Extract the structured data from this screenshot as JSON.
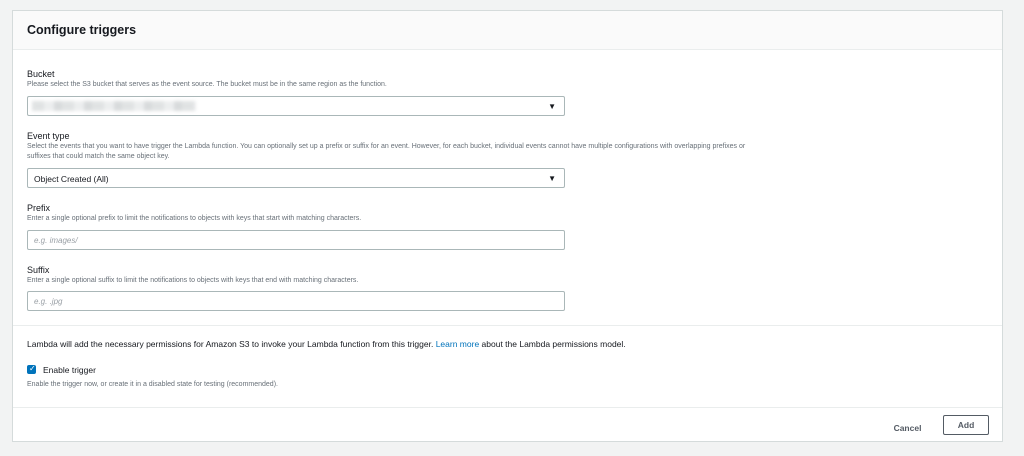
{
  "panel": {
    "title": "Configure triggers"
  },
  "bucket": {
    "label": "Bucket",
    "description": "Please select the S3 bucket that serves as the event source. The bucket must be in the same region as the function.",
    "selected_value_redacted": true
  },
  "event_type": {
    "label": "Event type",
    "description": "Select the events that you want to have trigger the Lambda function. You can optionally set up a prefix or suffix for an event. However, for each bucket, individual events cannot have multiple configurations with overlapping prefixes or suffixes that could match the same object key.",
    "selected_value": "Object Created (All)"
  },
  "prefix": {
    "label": "Prefix",
    "description": "Enter a single optional prefix to limit the notifications to objects with keys that start with matching characters.",
    "placeholder": "e.g. images/",
    "value": ""
  },
  "suffix": {
    "label": "Suffix",
    "description": "Enter a single optional suffix to limit the notifications to objects with keys that end with matching characters.",
    "placeholder": "e.g. .jpg",
    "value": ""
  },
  "permissions": {
    "text_before": "Lambda will add the necessary permissions for Amazon S3 to invoke your Lambda function from this trigger.",
    "link_label": "Learn more",
    "text_after": "about the Lambda permissions model."
  },
  "enable_trigger": {
    "label": "Enable trigger",
    "checked": true,
    "description": "Enable the trigger now, or create it in a disabled state for testing (recommended)."
  },
  "footer": {
    "cancel_label": "Cancel",
    "add_label": "Add"
  },
  "icons": {
    "dropdown": "caret-down-icon",
    "checkbox": "checkmark-icon"
  },
  "colors": {
    "link": "#0073bb",
    "checkbox": "#0073bb",
    "button_text": "#545b64"
  }
}
